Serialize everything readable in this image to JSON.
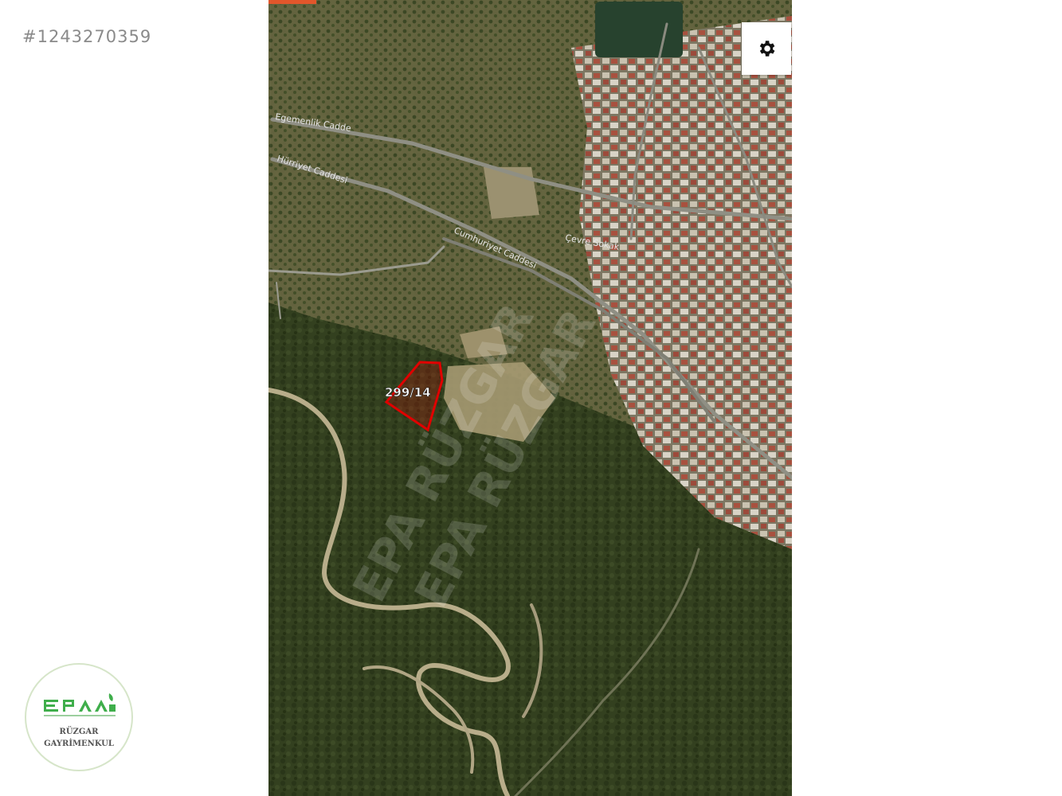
{
  "listing": {
    "id": "#1243270359"
  },
  "map": {
    "view": "satellite",
    "parcel": {
      "label": "299/14",
      "outline_color": "#e00000"
    },
    "streets": [
      {
        "name": "Egemenlik Cadde"
      },
      {
        "name": "Hürriyet Caddesi"
      },
      {
        "name": "Cumhuriyet Caddesi"
      },
      {
        "name": "Çevre Sokak"
      }
    ],
    "watermark": {
      "line1": "EPA RÜZGAR",
      "line2": "EPA RÜZGAR"
    },
    "controls": {
      "settings_icon": "gear-icon"
    }
  },
  "brand": {
    "logo_lettering": "EPA",
    "line1": "RÜZGAR",
    "line2": "GAYRİMENKUL",
    "green": "#3fae4b"
  }
}
